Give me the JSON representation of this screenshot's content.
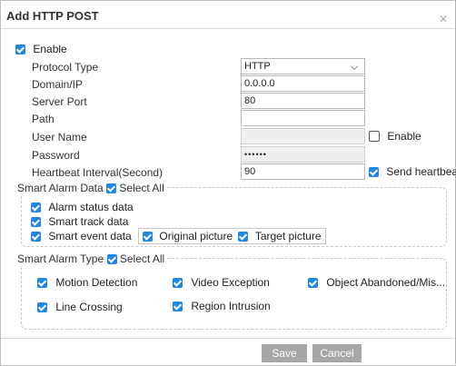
{
  "dialog": {
    "title": "Add HTTP POST"
  },
  "enable": {
    "label": "Enable",
    "checked": true
  },
  "fields": {
    "protocol_type": {
      "label": "Protocol Type",
      "value": "HTTP"
    },
    "domain_ip": {
      "label": "Domain/IP",
      "value": "0.0.0.0"
    },
    "server_port": {
      "label": "Server Port",
      "value": "80"
    },
    "path": {
      "label": "Path",
      "value": ""
    },
    "user_name": {
      "label": "User Name",
      "value": ""
    },
    "auth_enable": {
      "label": "Enable",
      "checked": false
    },
    "password": {
      "label": "Password",
      "value": "••••••"
    },
    "heartbeat": {
      "label": "Heartbeat Interval(Second)",
      "value": "90"
    },
    "send_heartbeat": {
      "label": "Send heartbeat",
      "checked": true
    }
  },
  "smart_alarm_data": {
    "legend": "Smart Alarm Data",
    "select_all": "Select All",
    "items": {
      "alarm_status": "Alarm status data",
      "smart_track": "Smart track data",
      "smart_event": "Smart event data",
      "original_picture": "Original picture",
      "target_picture": "Target picture"
    }
  },
  "smart_alarm_type": {
    "legend": "Smart Alarm Type",
    "select_all": "Select All",
    "items": {
      "motion_detection": "Motion Detection",
      "video_exception": "Video Exception",
      "object_abandoned": "Object Abandoned/Mis...",
      "line_crossing": "Line Crossing",
      "region_intrusion": "Region Intrusion"
    }
  },
  "buttons": {
    "save": "Save",
    "cancel": "Cancel"
  },
  "colors": {
    "checkbox": "#1e88e5",
    "button": "#a6a6a6"
  }
}
